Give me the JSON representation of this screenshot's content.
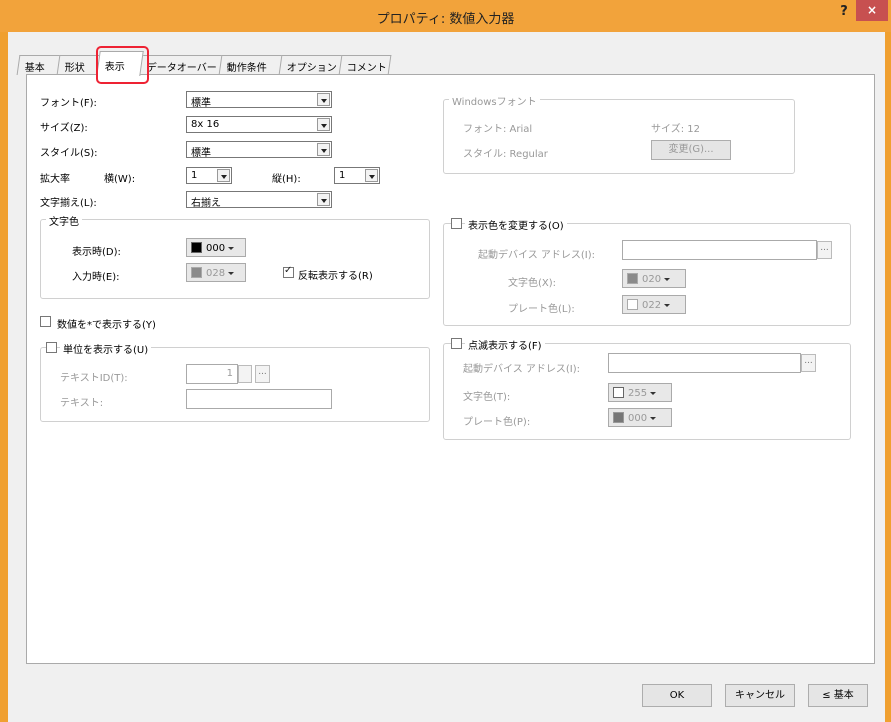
{
  "window": {
    "title": "プロパティ: 数値入力器",
    "help": "?",
    "close": "×"
  },
  "tabs": [
    "基本",
    "形状",
    "表示",
    "データオーバー",
    "動作条件",
    "オプション",
    "コメント"
  ],
  "font_section": {
    "font_label": "フォント(F):",
    "font_value": "標準",
    "size_label": "サイズ(Z):",
    "size_value": "8x 16",
    "style_label": "スタイル(S):",
    "style_value": "標準",
    "scale_label": "拡大率",
    "width_label": "横(W):",
    "width_value": "1",
    "height_label": "縦(H):",
    "height_value": "1",
    "align_label": "文字揃え(L):",
    "align_value": "右揃え"
  },
  "text_color": {
    "title": "文字色",
    "display_label": "表示時(D):",
    "display_value": "000",
    "display_color": "#000000",
    "input_label": "入力時(E):",
    "input_value": "028",
    "input_color": "#8a8a8a",
    "reverse_label": "反転表示する(R)"
  },
  "asterisk_label": "数値を*で表示する(Y)",
  "unit": {
    "title": "単位を表示する(U)",
    "textid_label": "テキストID(T):",
    "textid_value": "1",
    "text_label": "テキスト:",
    "text_value": ""
  },
  "windows_font": {
    "title": "Windowsフォント",
    "font": "フォント: Arial",
    "size": "サイズ: 12",
    "style": "スタイル: Regular",
    "change": "変更(G)..."
  },
  "change_color": {
    "title": "表示色を変更する(O)",
    "device_label": "起動デバイス アドレス(I):",
    "device_value": "",
    "text_label": "文字色(X):",
    "text_value": "020",
    "text_color": "#8a8a8a",
    "plate_label": "プレート色(L):",
    "plate_value": "022",
    "plate_color": "#ffffff"
  },
  "blink": {
    "title": "点滅表示する(F)",
    "device_label": "起動デバイス アドレス(I):",
    "device_value": "",
    "text_label": "文字色(T):",
    "text_value": "255",
    "text_color": "#ffffff",
    "plate_label": "プレート色(P):",
    "plate_value": "000",
    "plate_color": "#777777"
  },
  "buttons": {
    "ok": "OK",
    "cancel": "キャンセル",
    "basic": "≤ 基本"
  }
}
